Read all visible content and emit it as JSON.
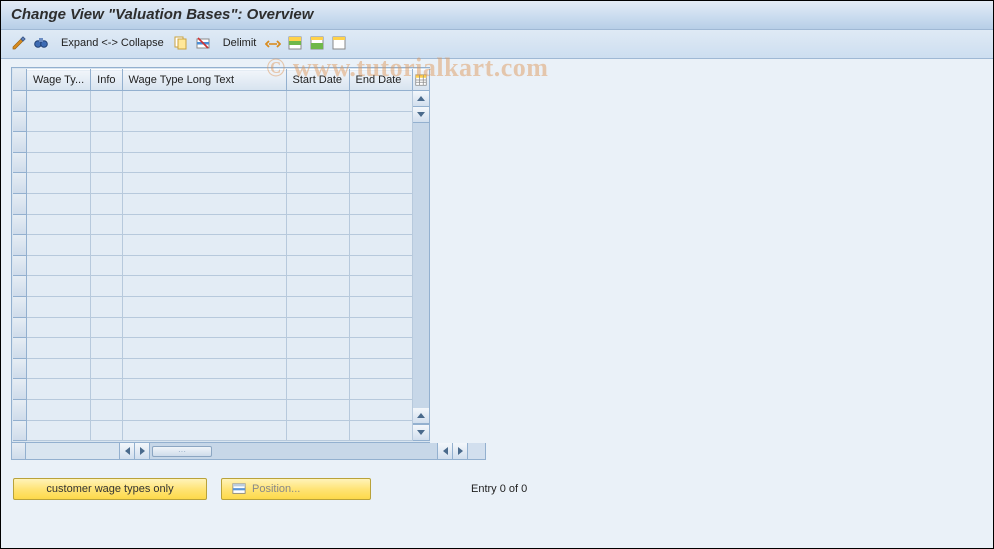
{
  "title": "Change View \"Valuation Bases\": Overview",
  "toolbar": {
    "expand_collapse": "Expand <-> Collapse",
    "delimit": "Delimit"
  },
  "columns": {
    "wage_type": "Wage Ty...",
    "info": "Info",
    "long_text": "Wage Type Long Text",
    "start_date": "Start Date",
    "end_date": "End Date"
  },
  "footer": {
    "customer_wage_btn": "customer wage types only",
    "position_btn": "Position...",
    "entry_text": "Entry 0 of 0"
  },
  "watermark": "© www.tutorialkart.com"
}
